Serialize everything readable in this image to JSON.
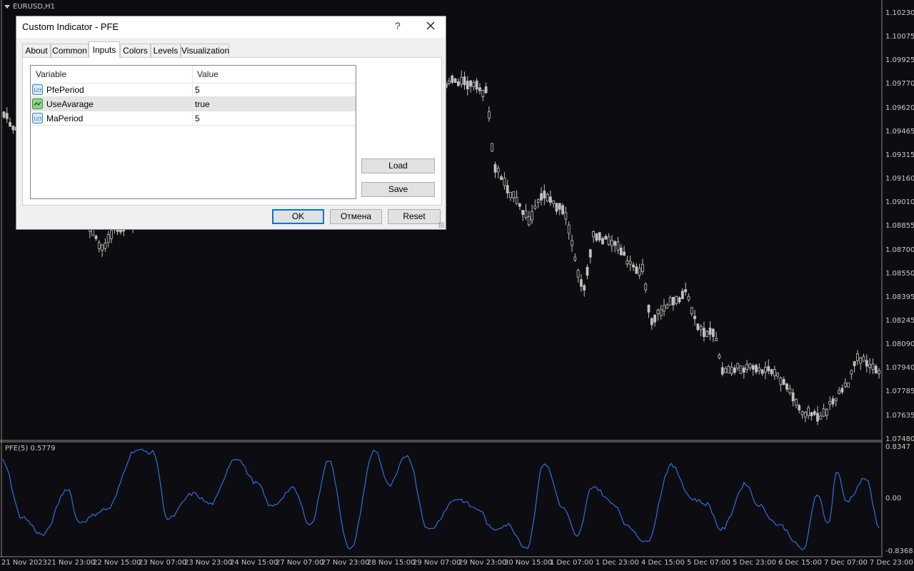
{
  "chart": {
    "symbol": "EURUSD,H1",
    "price_ticks": [
      "1.10230",
      "1.10075",
      "1.09925",
      "1.09770",
      "1.09620",
      "1.09465",
      "1.09315",
      "1.09160",
      "1.09010",
      "1.08855",
      "1.08700",
      "1.08550",
      "1.08395",
      "1.08245",
      "1.08090",
      "1.07940",
      "1.07785",
      "1.07635",
      "1.07480"
    ],
    "time_ticks": [
      "21 Nov 2023",
      "21 Nov 23:00",
      "22 Nov 15:00",
      "23 Nov 07:00",
      "23 Nov 23:00",
      "24 Nov 15:00",
      "27 Nov 07:00",
      "27 Nov 23:00",
      "28 Nov 15:00",
      "29 Nov 07:00",
      "29 Nov 23:00",
      "30 Nov 15:00",
      "1 Dec 07:00",
      "1 Dec 23:00",
      "4 Dec 15:00",
      "5 Dec 07:00",
      "5 Dec 23:00",
      "6 Dec 15:00",
      "7 Dec 07:00",
      "7 Dec 23:00"
    ],
    "indicator_label": "PFE(5) 0.5779",
    "indicator_ticks": [
      "0.8347",
      "0.00",
      "-0.8368"
    ],
    "colors": {
      "background": "#0d0c10",
      "candle": "#c0c0c0",
      "indicator_line": "#2f6fe0",
      "grid_line": "#888888"
    }
  },
  "dialog": {
    "title": "Custom Indicator - PFE",
    "help_label": "?",
    "close_icon": "close-icon",
    "tabs": [
      {
        "label": "About",
        "active": false
      },
      {
        "label": "Common",
        "active": false
      },
      {
        "label": "Inputs",
        "active": true
      },
      {
        "label": "Colors",
        "active": false
      },
      {
        "label": "Levels",
        "active": false
      },
      {
        "label": "Visualization",
        "active": false
      }
    ],
    "grid": {
      "headers": {
        "variable": "Variable",
        "value": "Value"
      },
      "rows": [
        {
          "icon": "integer-icon",
          "variable": "PfePeriod",
          "value": "5",
          "selected": false
        },
        {
          "icon": "boolean-icon",
          "variable": "UseAvarage",
          "value": "true",
          "selected": true
        },
        {
          "icon": "integer-icon",
          "variable": "MaPeriod",
          "value": "5",
          "selected": false
        }
      ]
    },
    "buttons": {
      "load": "Load",
      "save": "Save",
      "ok": "OK",
      "cancel": "Отмена",
      "reset": "Reset"
    }
  }
}
